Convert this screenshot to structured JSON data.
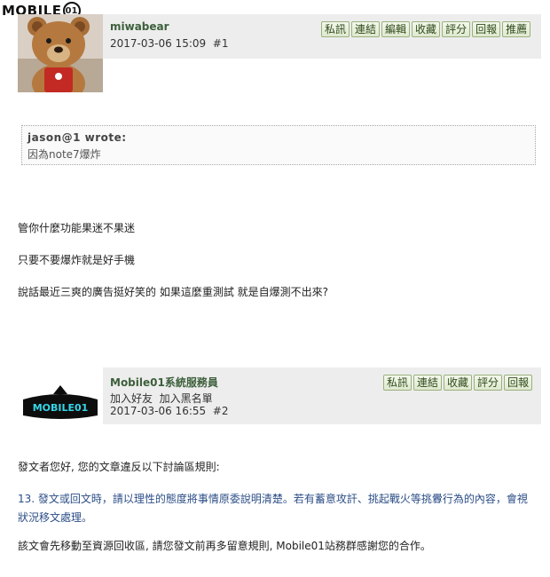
{
  "site": {
    "logo_text": "MOBILE",
    "logo_circle": "01"
  },
  "post1": {
    "username": "miwabear",
    "datetime": "2017-03-06 15:09",
    "number": "#1",
    "buttons": [
      "私訊",
      "連結",
      "編輯",
      "收藏",
      "評分",
      "回報",
      "推薦"
    ],
    "quote": {
      "author": "jason@1 wrote:",
      "text": "因為note7爆炸"
    },
    "lines": [
      "管你什麼功能果迷不果迷",
      "只要不要爆炸就是好手機",
      "說話最近三爽的廣告挺好笑的 如果這麼重測試 就是自爆測不出來?"
    ]
  },
  "post2": {
    "username": "Mobile01系統服務員",
    "add_friend": "加入好友",
    "add_blacklist": "加入黑名單",
    "datetime": "2017-03-06 16:55",
    "number": "#2",
    "buttons": [
      "私訊",
      "連結",
      "收藏",
      "評分",
      "回報"
    ],
    "avatar_text": "MOBILE01",
    "p1": "發文者您好, 您的文章違反以下討論區規則:",
    "p2": "13. 發文或回文時，請以理性的態度將事情原委說明清楚。若有蓄意攻訐、挑起戰火等挑釁行為的內容，會視狀況移文處理。",
    "p3": "該文會先移動至資源回收區, 請您發文前再多留意規則, Mobile01站務群感謝您的合作。"
  }
}
